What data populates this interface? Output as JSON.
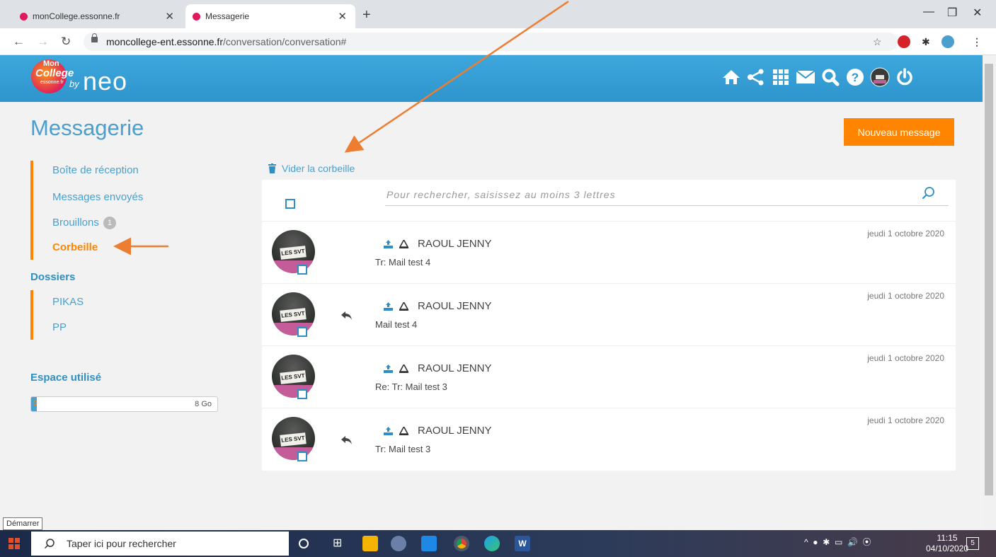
{
  "browser": {
    "tabs": [
      {
        "title": "monCollege.essonne.fr",
        "active": false
      },
      {
        "title": "Messagerie",
        "active": true
      }
    ],
    "new_tab": "+",
    "url_host": "moncollege-ent.essonne.fr",
    "url_path": "/conversation/conversation#"
  },
  "header": {
    "logo_mon": "Mon",
    "logo_college": "College",
    "logo_essonne": "essonne.fr",
    "logo_by": "by",
    "logo_neo": "neo",
    "icons": [
      "home-icon",
      "share-icon",
      "apps-grid-icon",
      "mail-icon",
      "search-icon",
      "help-icon",
      "avatar-icon",
      "power-icon"
    ]
  },
  "page": {
    "title": "Messagerie",
    "new_message": "Nouveau message",
    "empty_trash": "Vider la corbeille"
  },
  "sidebar": {
    "items": [
      {
        "label": "Boîte de réception"
      },
      {
        "label": "Messages envoyés"
      },
      {
        "label": "Brouillons",
        "badge": "1"
      },
      {
        "label": "Corbeille",
        "active": true
      }
    ],
    "folders_title": "Dossiers",
    "folders": [
      {
        "label": "PIKAS"
      },
      {
        "label": "PP"
      }
    ],
    "space_title": "Espace utilisé",
    "space_min": "0",
    "space_max": "8 Go",
    "space_used_fraction": 0.03
  },
  "search": {
    "placeholder": "Pour rechercher, saisissez au moins 3 lettres"
  },
  "messages": [
    {
      "sender": "RAOUL JENNY",
      "subject": "Tr: Mail test 4",
      "date": "jeudi 1 octobre 2020",
      "replied": false
    },
    {
      "sender": "RAOUL JENNY",
      "subject": "Mail test 4",
      "date": "jeudi 1 octobre 2020",
      "replied": true
    },
    {
      "sender": "RAOUL JENNY",
      "subject": "Re: Tr: Mail test 3",
      "date": "jeudi 1 octobre 2020",
      "replied": false
    },
    {
      "sender": "RAOUL JENNY",
      "subject": "Tr: Mail test 3",
      "date": "jeudi 1 octobre 2020",
      "replied": true
    }
  ],
  "avatar_sign": "LES SVT",
  "os": {
    "tooltip": "Démarrer",
    "search_placeholder": "Taper ici pour rechercher",
    "time": "11:15",
    "date": "04/10/2020",
    "notifications": "5"
  },
  "colors": {
    "accent_blue": "#4a9fcf",
    "accent_orange": "#ff8500",
    "header_blue": "#2e95cd"
  }
}
